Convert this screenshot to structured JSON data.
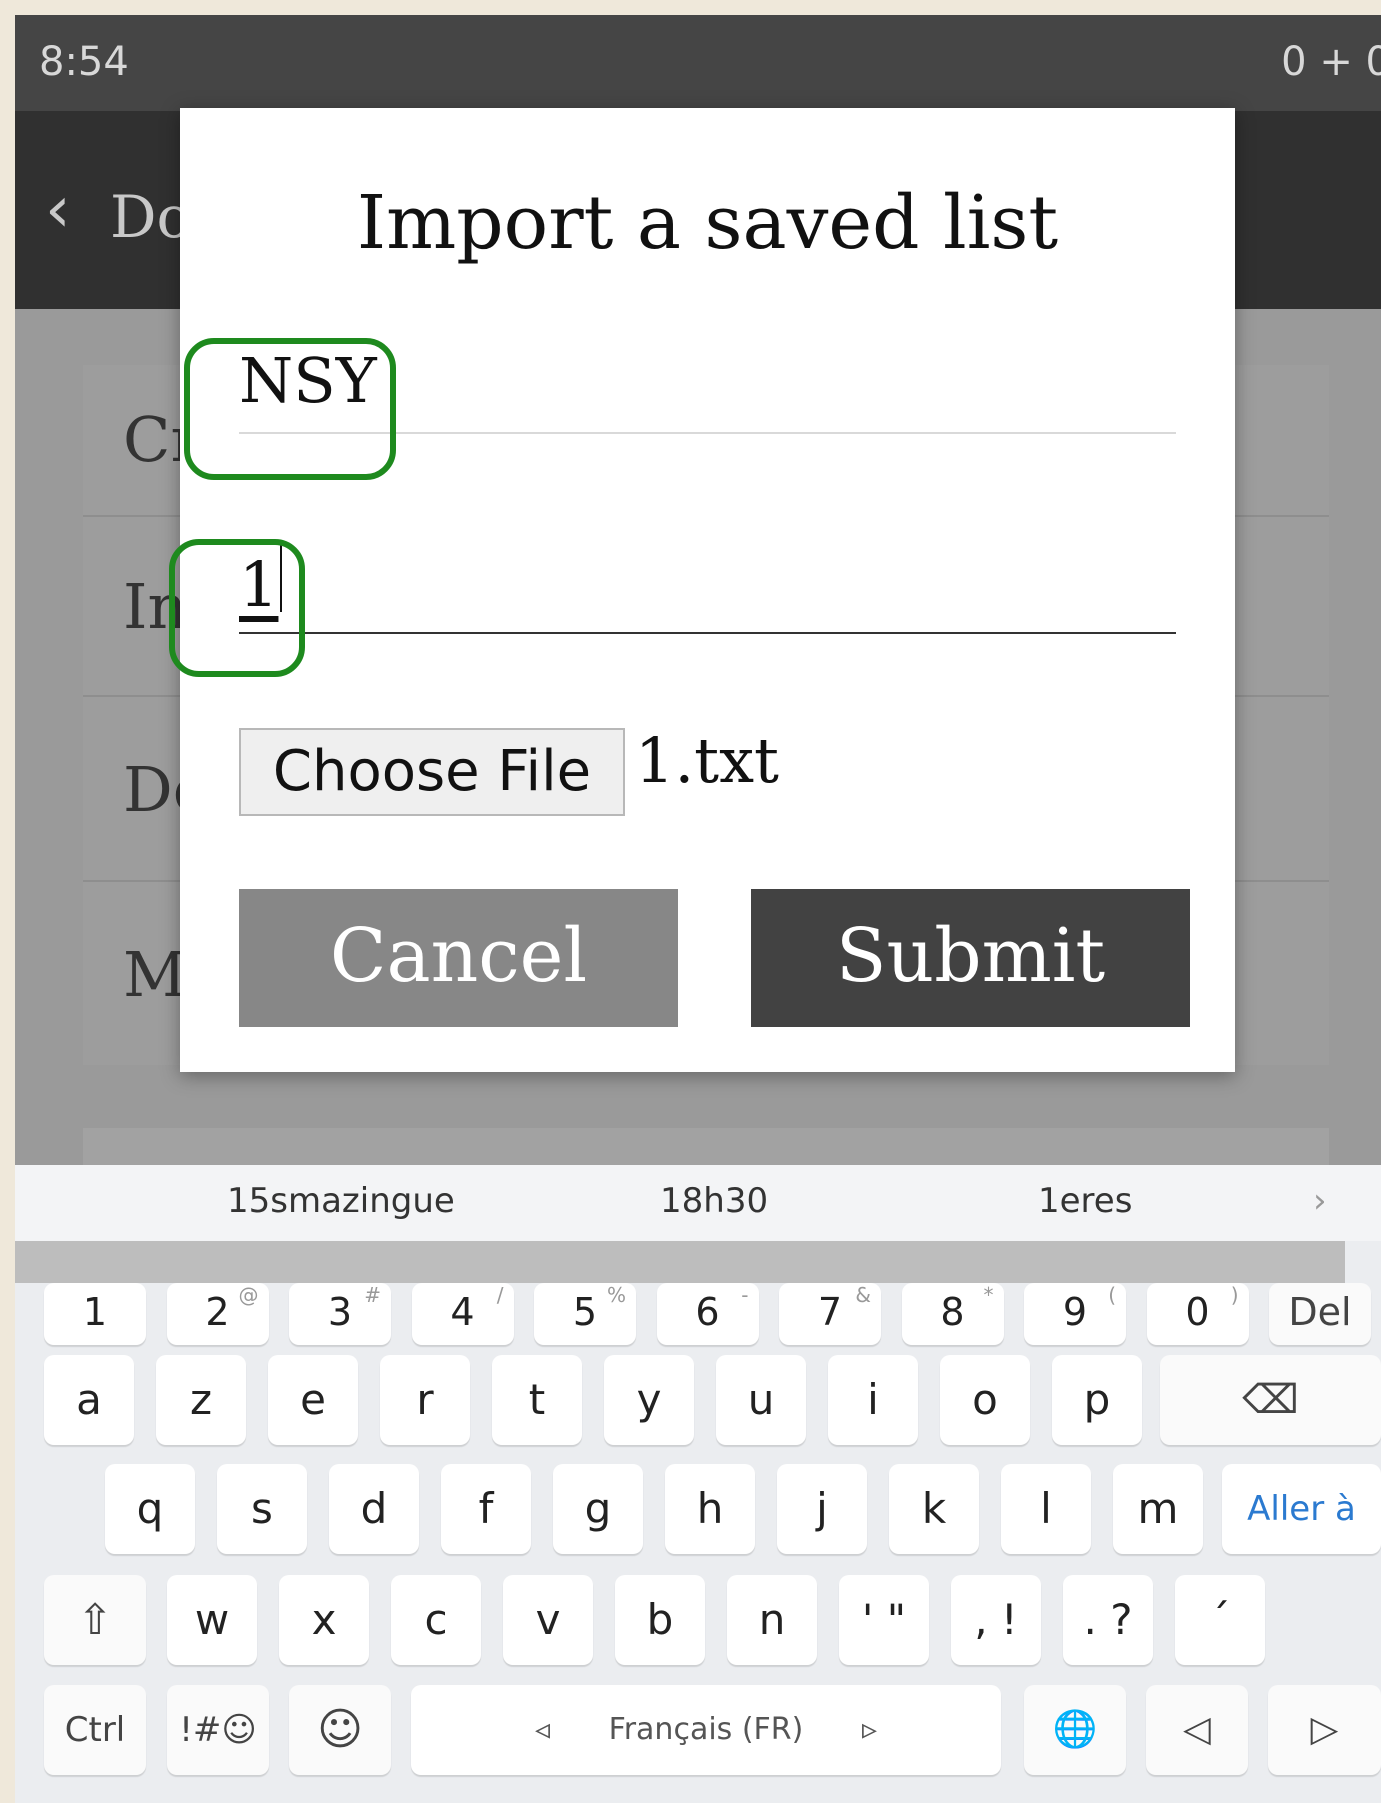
{
  "status_bar": {
    "time": "8:54",
    "right": "0 + 0"
  },
  "app_bar": {
    "back_label": "Do"
  },
  "background_list": {
    "rows": [
      "Cr",
      "In",
      "De",
      "Ma"
    ]
  },
  "dialog": {
    "title": "Import a saved list",
    "field1_value": "NSY",
    "field2_value": "1",
    "choose_file_label": "Choose File",
    "file_name": "1.txt",
    "cancel_label": "Cancel",
    "submit_label": "Submit",
    "highlight_color": "#1e8a1e"
  },
  "keyboard": {
    "suggestions": [
      "15smazingue",
      "18h30",
      "1eres",
      "›"
    ],
    "number_row": [
      {
        "k": "1",
        "s": ""
      },
      {
        "k": "2",
        "s": "@"
      },
      {
        "k": "3",
        "s": "#"
      },
      {
        "k": "4",
        "s": "/"
      },
      {
        "k": "5",
        "s": "%"
      },
      {
        "k": "6",
        "s": "-"
      },
      {
        "k": "7",
        "s": "&"
      },
      {
        "k": "8",
        "s": "*"
      },
      {
        "k": "9",
        "s": "("
      },
      {
        "k": "0",
        "s": ")"
      },
      {
        "k": "Del",
        "s": ""
      }
    ],
    "row1": [
      "a",
      "z",
      "e",
      "r",
      "t",
      "y",
      "u",
      "i",
      "o",
      "p"
    ],
    "row2": [
      "q",
      "s",
      "d",
      "f",
      "g",
      "h",
      "j",
      "k",
      "l",
      "m"
    ],
    "row3": [
      "w",
      "x",
      "c",
      "v",
      "b",
      "n",
      "' \"",
      ", !",
      ". ?",
      "´"
    ],
    "aller_label": "Aller à",
    "backspace_icon": "⌫",
    "shift_icon": "⇧",
    "ctrl_label": "Ctrl",
    "symbols_label": "!#☺",
    "emoji_icon": "☺",
    "space_label": "Français (FR)",
    "space_left": "◃",
    "space_right": "▹",
    "globe_icon": "🌐",
    "left_arrow_icon": "◁",
    "right_arrow_icon": "▷"
  }
}
